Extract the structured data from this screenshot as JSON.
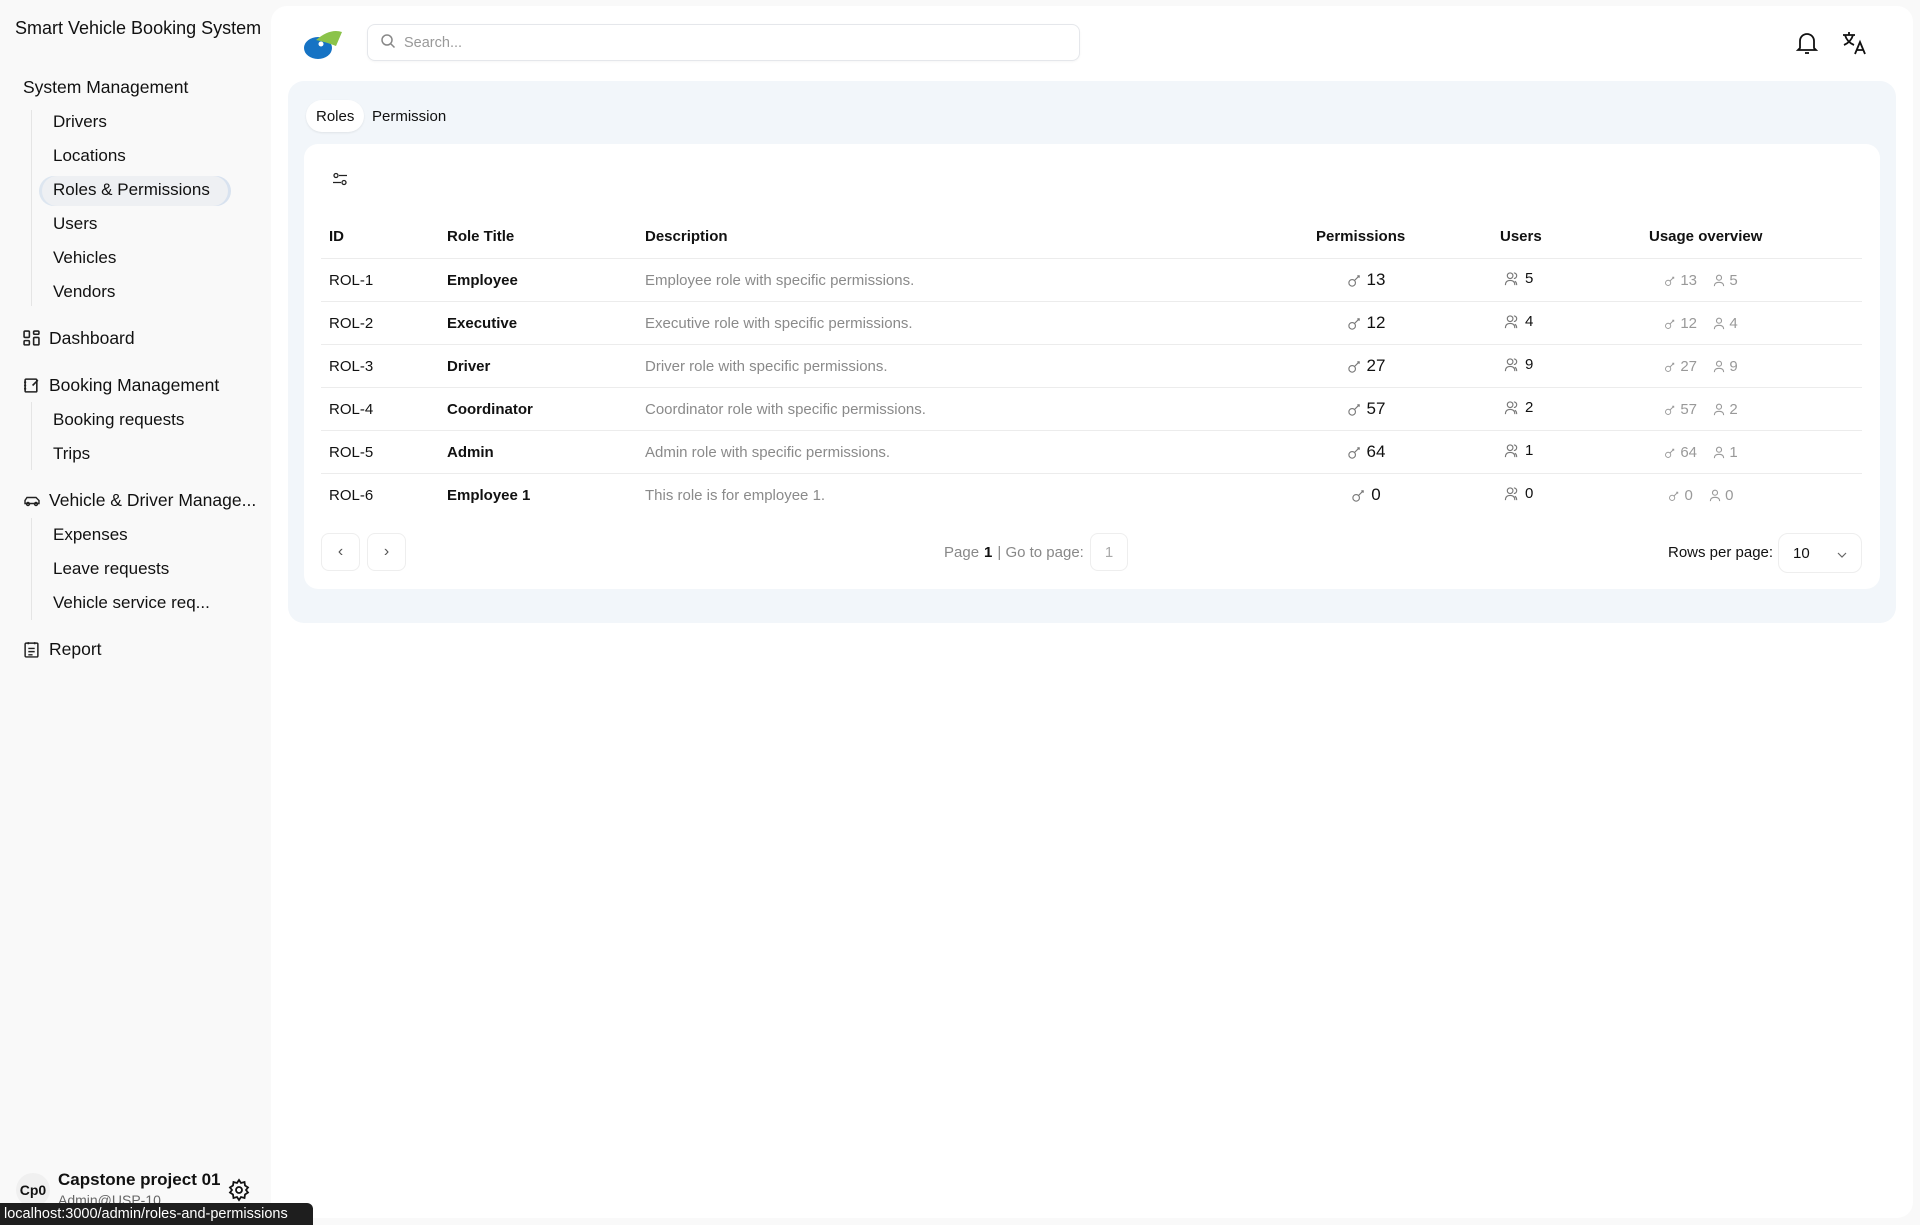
{
  "app": {
    "title": "Smart Vehicle Booking System"
  },
  "sidebar": {
    "system_management": "System Management",
    "system_items": [
      "Drivers",
      "Locations",
      "Roles & Permissions",
      "Users",
      "Vehicles",
      "Vendors"
    ],
    "dashboard": "Dashboard",
    "booking_management": "Booking Management",
    "booking_items": [
      "Booking requests",
      "Trips"
    ],
    "vehicle_driver": "Vehicle & Driver Manage...",
    "vehicle_items": [
      "Expenses",
      "Leave requests",
      "Vehicle service req..."
    ],
    "report": "Report",
    "user": {
      "avatar": "Cp0",
      "name": "Capstone project 01",
      "email": "Admin@USP-10"
    }
  },
  "header": {
    "search_placeholder": "Search..."
  },
  "tabs": [
    "Roles",
    "Permission"
  ],
  "table": {
    "columns": [
      "ID",
      "Role Title",
      "Description",
      "Permissions",
      "Users",
      "Usage overview"
    ],
    "rows": [
      {
        "id": "ROL-1",
        "title": "Employee",
        "desc": "Employee role with specific permissions.",
        "perms": "13",
        "users": "5"
      },
      {
        "id": "ROL-2",
        "title": "Executive",
        "desc": "Executive role with specific permissions.",
        "perms": "12",
        "users": "4"
      },
      {
        "id": "ROL-3",
        "title": "Driver",
        "desc": "Driver role with specific permissions.",
        "perms": "27",
        "users": "9"
      },
      {
        "id": "ROL-4",
        "title": "Coordinator",
        "desc": "Coordinator role with specific permissions.",
        "perms": "57",
        "users": "2"
      },
      {
        "id": "ROL-5",
        "title": "Admin",
        "desc": "Admin role with specific permissions.",
        "perms": "64",
        "users": "1"
      },
      {
        "id": "ROL-6",
        "title": "Employee 1",
        "desc": "This role is for employee 1.",
        "perms": "0",
        "users": "0"
      }
    ]
  },
  "pagination": {
    "page_label": "Page",
    "page": "1",
    "goto_label": "| Go to page:",
    "goto_value": "1",
    "rows_label": "Rows per page:",
    "rows_value": "10"
  },
  "status_url": "localhost:3000/admin/roles-and-permissions",
  "colors": {
    "panel": "#f2f6fa",
    "logo_blue": "#1673c4",
    "logo_green": "#8bc34a"
  }
}
